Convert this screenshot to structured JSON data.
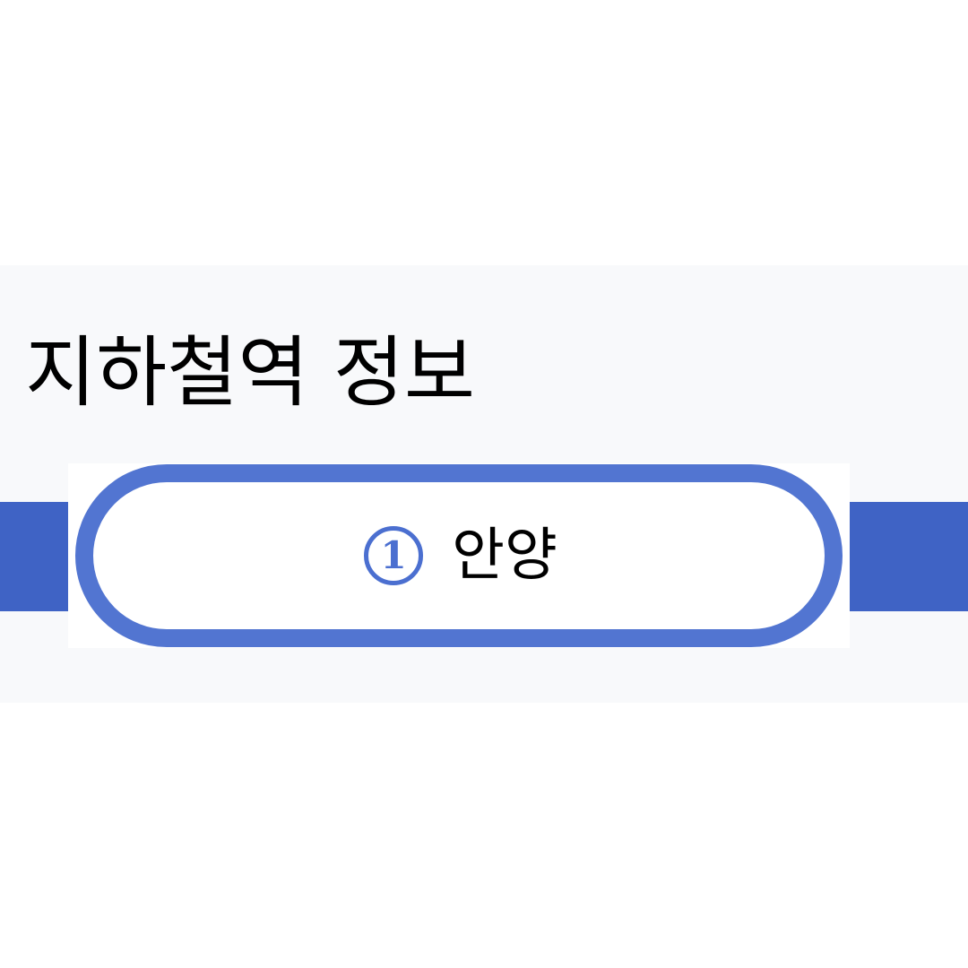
{
  "section": {
    "title": "지하철역 정보"
  },
  "station": {
    "line_number": "1",
    "name": "안양",
    "line_color": "#3f63c5",
    "border_color": "#5275d1"
  }
}
